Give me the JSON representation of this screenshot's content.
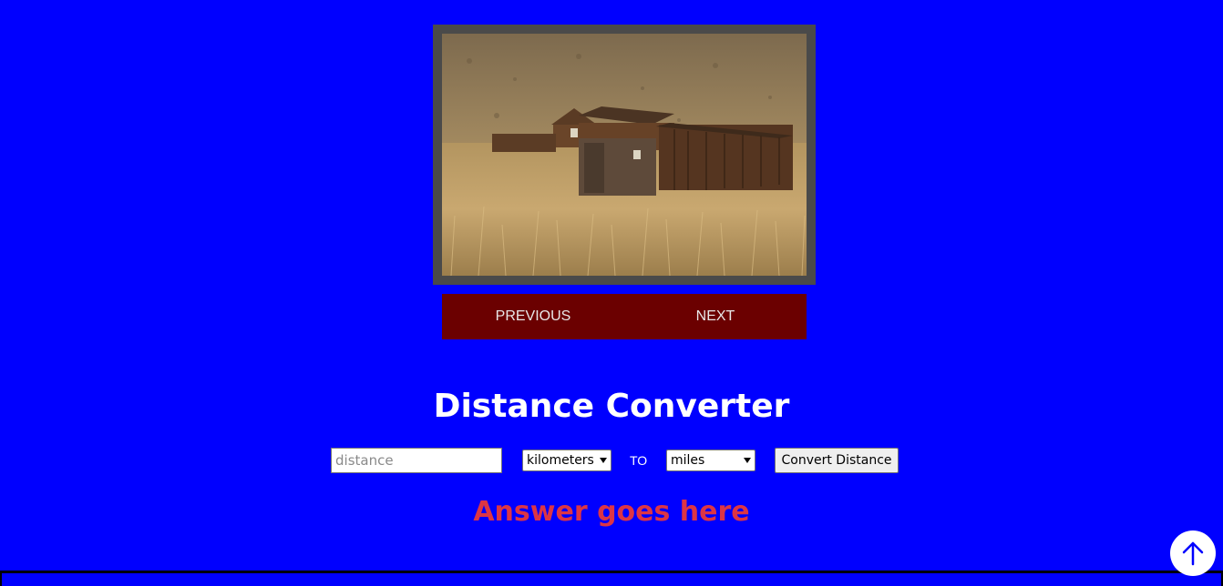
{
  "slideshow": {
    "photo_icon": "ghost-town-cabins-photo",
    "previous_label": "PREVIOUS",
    "next_label": "NEXT"
  },
  "converter": {
    "title": "Distance Converter",
    "distance_placeholder": "distance",
    "distance_value": "",
    "from_unit": "kilometers",
    "to_text": "TO",
    "to_unit": "miles",
    "convert_label": "Convert Distance",
    "answer": "Answer goes here"
  },
  "back_to_top": {
    "icon": "arrow-up-icon"
  },
  "colors": {
    "background": "#0000ff",
    "nav_bar": "#6b0000",
    "answer_text": "#dc3545",
    "frame": "#4a4a4a"
  }
}
